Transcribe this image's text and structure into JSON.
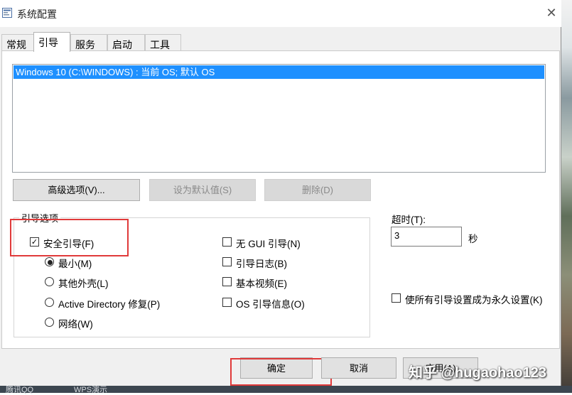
{
  "window": {
    "title": "系统配置"
  },
  "tabs": [
    "常规",
    "引导",
    "服务",
    "启动",
    "工具"
  ],
  "boot_list": {
    "entries": [
      "Windows 10 (C:\\WINDOWS) : 当前 OS; 默认 OS"
    ]
  },
  "boot_buttons": {
    "advanced": "高级选项(V)...",
    "set_default": "设为默认值(S)",
    "delete": "删除(D)"
  },
  "boot_options": {
    "title": "引导选项",
    "safe_boot": "安全引导(F)",
    "radios": [
      "最小(M)",
      "其他外壳(L)",
      "Active Directory 修复(P)",
      "网络(W)"
    ],
    "checks": [
      "无 GUI 引导(N)",
      "引导日志(B)",
      "基本视频(E)",
      "OS 引导信息(O)"
    ]
  },
  "timeout": {
    "label": "超时(T):",
    "value": "3",
    "unit": "秒"
  },
  "permanent": "使所有引导设置成为永久设置(K)",
  "footer": {
    "ok": "确定",
    "cancel": "取消",
    "apply": "应用(A)"
  },
  "taskbar": [
    "腾讯QQ",
    "WPS演示"
  ],
  "watermark": "知乎 @hugaohao123",
  "colors": {
    "selection": "#1e90ff",
    "highlight": "#e03a3a"
  }
}
